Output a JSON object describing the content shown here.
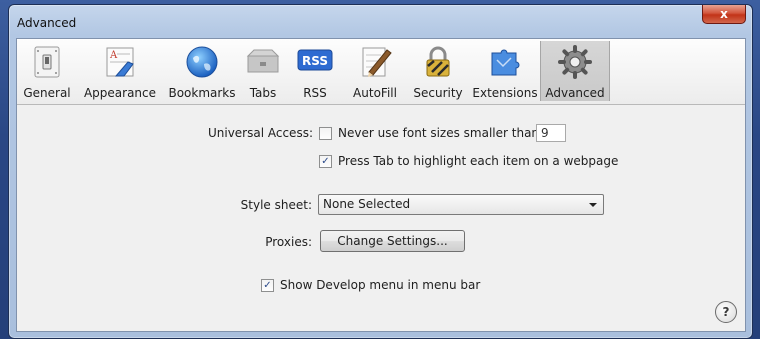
{
  "window": {
    "title": "Advanced",
    "close_glyph": "x"
  },
  "toolbar": {
    "tabs": [
      {
        "label": "General",
        "icon": "switch-icon"
      },
      {
        "label": "Appearance",
        "icon": "appearance-icon"
      },
      {
        "label": "Bookmarks",
        "icon": "globe-icon"
      },
      {
        "label": "Tabs",
        "icon": "tabs-icon"
      },
      {
        "label": "RSS",
        "icon": "rss-icon"
      },
      {
        "label": "AutoFill",
        "icon": "pencil-icon"
      },
      {
        "label": "Security",
        "icon": "lock-icon"
      },
      {
        "label": "Extensions",
        "icon": "puzzle-icon"
      },
      {
        "label": "Advanced",
        "icon": "gear-icon"
      }
    ],
    "rss_badge": "RSS",
    "selected": "Advanced"
  },
  "universal_access": {
    "label": "Universal Access:",
    "min_font_checkbox": {
      "label": "Never use font sizes smaller than",
      "checked": false
    },
    "min_font_value": "9",
    "tab_highlight_checkbox": {
      "label": "Press Tab to highlight each item on a webpage",
      "checked": true
    }
  },
  "style_sheet": {
    "label": "Style sheet:",
    "value": "None Selected"
  },
  "proxies": {
    "label": "Proxies:",
    "button_label": "Change Settings..."
  },
  "develop_menu_checkbox": {
    "label": "Show Develop menu in menu bar",
    "checked": true
  },
  "help": {
    "glyph": "?"
  },
  "colors": {
    "accent": "#2b4a8a",
    "desktop": "#2c4a86",
    "close": "#c23318"
  }
}
